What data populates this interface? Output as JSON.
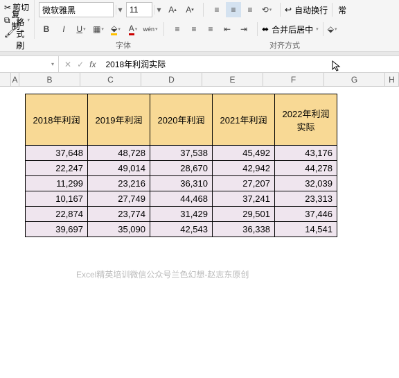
{
  "ribbon": {
    "clipboard": {
      "cut": "剪切",
      "copy": "复制",
      "painter": "格式刷"
    },
    "font": {
      "name": "微软雅黑",
      "size": "11",
      "bold": "B",
      "italic": "I",
      "underline": "U"
    },
    "wrap_label": "自动换行",
    "merge_label": "合并后居中",
    "style_label": "常",
    "group_font": "字体",
    "group_align": "对齐方式"
  },
  "formula_bar": {
    "namebox": "",
    "value": "2018年利润实际"
  },
  "columns": [
    "A",
    "B",
    "C",
    "D",
    "E",
    "F",
    "G",
    "H"
  ],
  "chart_data": {
    "type": "table",
    "title": "",
    "headers": [
      "2018年利润",
      "2019年利润",
      "2020年利润",
      "2021年利润",
      "2022年利润实际"
    ],
    "rows": [
      [
        "37,648",
        "48,728",
        "37,538",
        "45,492",
        "43,176"
      ],
      [
        "22,247",
        "49,014",
        "28,670",
        "42,942",
        "44,278"
      ],
      [
        "11,299",
        "23,216",
        "36,310",
        "27,207",
        "32,039"
      ],
      [
        "10,167",
        "27,749",
        "44,468",
        "37,241",
        "23,313"
      ],
      [
        "22,874",
        "23,774",
        "31,429",
        "29,501",
        "37,446"
      ],
      [
        "39,697",
        "35,090",
        "42,543",
        "36,338",
        "14,541"
      ]
    ]
  },
  "footer": "Excel精英培训微信公众号兰色幻想-赵志东原创"
}
